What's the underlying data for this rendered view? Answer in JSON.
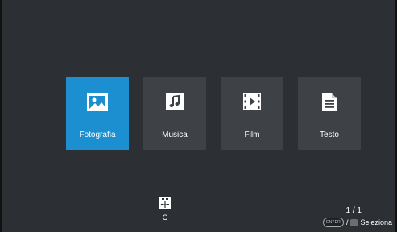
{
  "menu": {
    "items": [
      {
        "label": "Fotografia",
        "icon": "photo-icon",
        "selected": true
      },
      {
        "label": "Musica",
        "icon": "music-icon",
        "selected": false
      },
      {
        "label": "Film",
        "icon": "film-icon",
        "selected": false
      },
      {
        "label": "Testo",
        "icon": "document-icon",
        "selected": false
      }
    ]
  },
  "device": {
    "icon": "usb-drive-icon",
    "label": "C"
  },
  "footer": {
    "page": "1 / 1",
    "enter_key": "ENTER",
    "separator": "/",
    "select_label": "Seleziona"
  },
  "colors": {
    "background": "#2c3034",
    "tile": "#3e4246",
    "selected_tile": "#1c8fd0"
  }
}
